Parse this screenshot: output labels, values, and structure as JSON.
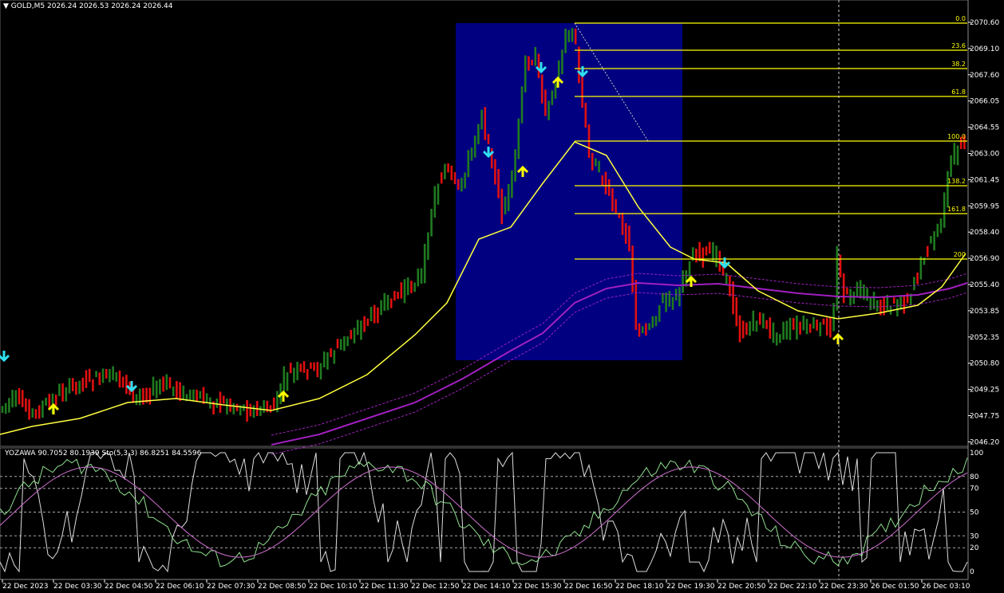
{
  "header": {
    "arrow": "▼",
    "symbol": "GOLD,M5",
    "ohlc": "2026.24 2026.53 2026.24 2026.44"
  },
  "oscillator": {
    "label": "YOZAWA 90.7052 80.1939  Sto(5,3,3) 86.8251 84.5596",
    "levels": [
      "100",
      "80",
      "70",
      "50",
      "30",
      "20",
      "0"
    ]
  },
  "price_axis": [
    "2070.60",
    "2069.10",
    "2067.60",
    "2066.05",
    "2064.55",
    "2063.00",
    "2061.45",
    "2059.95",
    "2058.40",
    "2056.90",
    "2055.40",
    "2053.85",
    "2052.35",
    "2050.80",
    "2049.25",
    "2047.75",
    "2046.20"
  ],
  "fib_levels": [
    "0.0",
    "23.6",
    "38.2",
    "61.8",
    "100.0",
    "138.2",
    "161.8",
    "200"
  ],
  "time_axis": [
    "22 Dec 2023",
    "22 Dec 03:30",
    "22 Dec 04:50",
    "22 Dec 06:10",
    "22 Dec 07:30",
    "22 Dec 08:50",
    "22 Dec 10:10",
    "22 Dec 11:30",
    "22 Dec 12:50",
    "22 Dec 14:10",
    "22 Dec 15:30",
    "22 Dec 16:50",
    "22 Dec 18:10",
    "22 Dec 19:30",
    "22 Dec 20:50",
    "22 Dec 22:10",
    "22 Dec 23:30",
    "26 Dec 01:50",
    "26 Dec 03:10"
  ],
  "colors": {
    "background": "#000000",
    "bull": "#1f7a1f",
    "bear": "#e01010",
    "ma_fast": "#ffff40",
    "ma_slow": "#a020c0",
    "fib": "#ffff00",
    "box": "#000080",
    "arrow_down": "#30e0f0",
    "arrow_up": "#ffff00"
  }
}
